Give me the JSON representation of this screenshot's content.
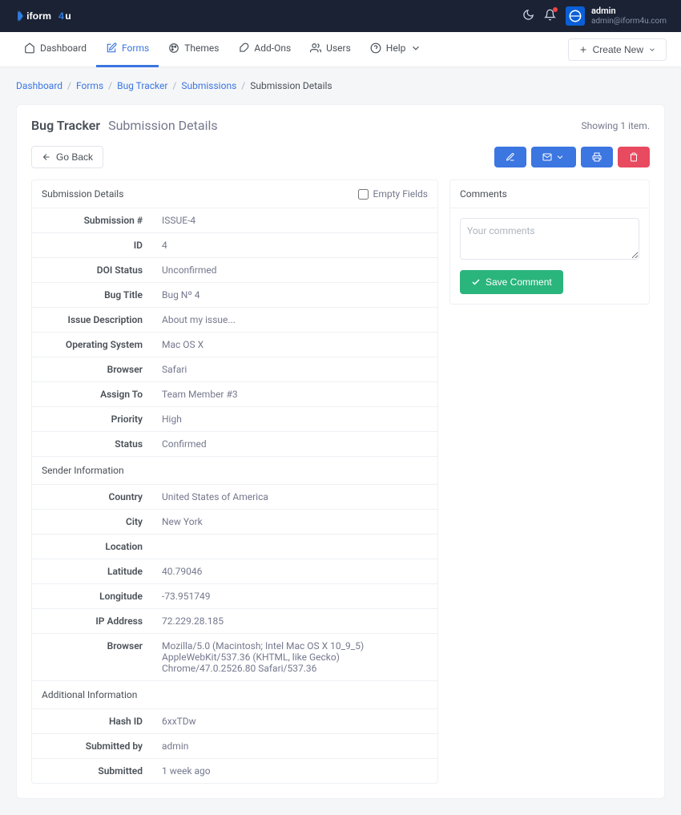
{
  "header": {
    "user_name": "admin",
    "user_email": "admin@iform4u.com"
  },
  "nav": {
    "items": [
      {
        "label": "Dashboard"
      },
      {
        "label": "Forms"
      },
      {
        "label": "Themes"
      },
      {
        "label": "Add-Ons"
      },
      {
        "label": "Users"
      },
      {
        "label": "Help"
      }
    ],
    "create_label": "Create New"
  },
  "breadcrumb": {
    "items": [
      "Dashboard",
      "Forms",
      "Bug Tracker",
      "Submissions"
    ],
    "current": "Submission Details"
  },
  "page": {
    "title_main": "Bug Tracker",
    "title_sub": "Submission Details",
    "showing": "Showing 1 item.",
    "go_back": "Go Back"
  },
  "submission_panel": {
    "header": "Submission Details",
    "empty_fields_label": "Empty Fields",
    "fields": {
      "submission_number": {
        "label": "Submission #",
        "value": "ISSUE-4"
      },
      "id": {
        "label": "ID",
        "value": "4"
      },
      "doi_status": {
        "label": "DOI Status",
        "value": "Unconfirmed"
      },
      "bug_title": {
        "label": "Bug Title",
        "value": "Bug Nº 4"
      },
      "issue_description": {
        "label": "Issue Description",
        "value": "About my issue..."
      },
      "operating_system": {
        "label": "Operating System",
        "value": "Mac OS X"
      },
      "browser": {
        "label": "Browser",
        "value": "Safari"
      },
      "assign_to": {
        "label": "Assign To",
        "value": "Team Member #3"
      },
      "priority": {
        "label": "Priority",
        "value": "High"
      },
      "status": {
        "label": "Status",
        "value": "Confirmed"
      }
    },
    "sender_header": "Sender Information",
    "sender": {
      "country": {
        "label": "Country",
        "value": "United States of America"
      },
      "city": {
        "label": "City",
        "value": "New York"
      },
      "location": {
        "label": "Location",
        "value": ""
      },
      "latitude": {
        "label": "Latitude",
        "value": "40.79046"
      },
      "longitude": {
        "label": "Longitude",
        "value": "-73.951749"
      },
      "ip_address": {
        "label": "IP Address",
        "value": "72.229.28.185"
      },
      "browser_full": {
        "label": "Browser",
        "value": "Mozilla/5.0 (Macintosh; Intel Mac OS X 10_9_5) AppleWebKit/537.36 (KHTML, like Gecko) Chrome/47.0.2526.80 Safari/537.36"
      }
    },
    "additional_header": "Additional Information",
    "additional": {
      "hash_id": {
        "label": "Hash ID",
        "value": "6xxTDw"
      },
      "submitted_by": {
        "label": "Submitted by",
        "value": "admin"
      },
      "submitted": {
        "label": "Submitted",
        "value": "1 week ago"
      }
    }
  },
  "comments": {
    "header": "Comments",
    "placeholder": "Your comments",
    "save_label": "Save Comment"
  }
}
